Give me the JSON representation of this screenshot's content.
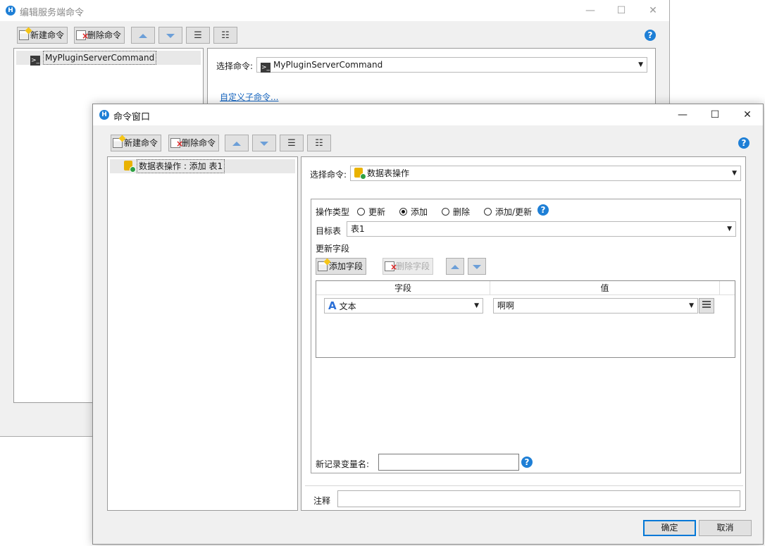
{
  "back_window": {
    "title": "编辑服务端命令",
    "toolbar": {
      "new_label": "新建命令",
      "delete_label": "删除命令"
    },
    "tree_item_label": "MyPluginServerCommand",
    "select_command_label": "选择命令:",
    "select_command_value": "MyPluginServerCommand",
    "custom_link": "自定义子命令..."
  },
  "front_window": {
    "title": "命令窗口",
    "toolbar": {
      "new_label": "新建命令",
      "delete_label": "删除命令"
    },
    "tree_item_label": "数据表操作 : 添加 表1",
    "select_command_label": "选择命令:",
    "select_command_value": "数据表操作",
    "operation_type_label": "操作类型",
    "operation_options": [
      "更新",
      "添加",
      "删除",
      "添加/更新"
    ],
    "operation_selected": "添加",
    "target_table_label": "目标表",
    "target_table_value": "表1",
    "update_fields_label": "更新字段",
    "add_field_label": "添加字段",
    "delete_field_label": "删除字段",
    "grid": {
      "columns": [
        "字段",
        "值"
      ],
      "rows": [
        {
          "field_icon": "A",
          "field": "文本",
          "value": "啊啊"
        }
      ]
    },
    "new_record_var_label": "新记录变量名:",
    "new_record_var_value": "",
    "comment_label": "注释",
    "comment_value": "",
    "ok_label": "确定",
    "cancel_label": "取消"
  },
  "window_controls": {
    "minimize": "—",
    "maximize": "☐",
    "close": "✕"
  },
  "colors": {
    "accent": "#1e7fd6",
    "link": "#1565c0",
    "dialog_bg": "#f0f0f0"
  }
}
